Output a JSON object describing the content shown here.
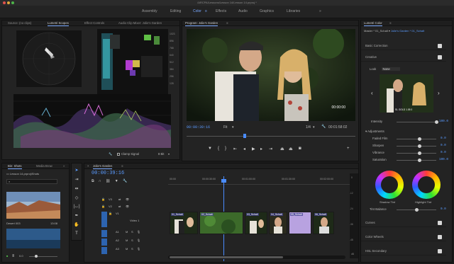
{
  "window": {
    "title": "/ARCPA/Lessons/Lesson 14/Lesson 14.prproj *"
  },
  "workspaces": {
    "items": [
      "Assembly",
      "Editing",
      "Color",
      "Effects",
      "Audio",
      "Graphics",
      "Libraries"
    ],
    "active": "Color",
    "more": "»"
  },
  "source_panel": {
    "tabs": [
      "Source: (no clips)",
      "Lumetri Scopes",
      "Effect Controls",
      "Audio Clip Mixer: Jolie's Garden"
    ],
    "active_tab": "Lumetri Scopes",
    "clamp_signal_label": "Clamp Signal",
    "bit_depth": "8 Bit",
    "scale_values": [
      "1023",
      "896",
      "768",
      "640",
      "512",
      "384",
      "256",
      "128",
      "0"
    ]
  },
  "program_monitor": {
    "title": "Program: Jolie's Garden",
    "overlay_timecode": "00:00:00",
    "timecode": "00:00:39:16",
    "fit": "Fit",
    "quality": "1/4",
    "duration": "00:01:58:02"
  },
  "lumetri": {
    "title": "Lumetri Color",
    "breadcrumb_master": "Master * 01_Schalt",
    "breadcrumb_seq": "Jolie's Garden * 01_Schalt",
    "basic_correction": "Basic Correction",
    "creative": "Creative",
    "look_label": "Look",
    "look_value": "None",
    "preview_caption": "SL GOLD 1.05 0",
    "intensity": "Intensity",
    "intensity_value": "100.0",
    "adjustments": "Adjustments",
    "adjust_rows": [
      {
        "label": "Faded Film",
        "value": "0.0"
      },
      {
        "label": "Sharpen",
        "value": "0.0"
      },
      {
        "label": "Vibrance",
        "value": "0.0"
      },
      {
        "label": "Saturation",
        "value": "100.0"
      }
    ],
    "shadow_tint": "Shadow Tint",
    "highlight_tint": "Highlight Tint",
    "tint_balance": "Tint Balance",
    "tint_balance_value": "0.0",
    "sections": [
      "Curves",
      "Color Wheels",
      "HSL Secondary"
    ]
  },
  "project_panel": {
    "tabs": [
      "Bin: Shots",
      "Media Brow"
    ],
    "path": "Lesson 14.prproj\\Shots",
    "search_placeholder": "",
    "clips": [
      {
        "name": "Desert 003",
        "duration": "13:08"
      },
      {
        "name": "",
        "duration": ""
      }
    ],
    "zoom": "0.0"
  },
  "timeline": {
    "tab": "Jolie's Garden",
    "timecode": "00:00:39:16",
    "ruler": [
      "00:00",
      "00:00:30:00",
      "00:01:00:00",
      "00:01:30:00",
      "00:02:00:00",
      "00:02:30:00"
    ],
    "video_tracks": [
      "V3",
      "V2",
      "V1"
    ],
    "audio_tracks": [
      "A1",
      "A2",
      "A3"
    ],
    "v1_label": "Video 1",
    "clips": [
      "01_Schalt",
      "02_Schalt",
      "03_Schalt",
      "04_Schalt",
      "05_Schalt",
      "06_Schalt"
    ],
    "audio_meter_ticks": [
      "0",
      "-12",
      "-24",
      "-36",
      "-48",
      "dB"
    ]
  }
}
